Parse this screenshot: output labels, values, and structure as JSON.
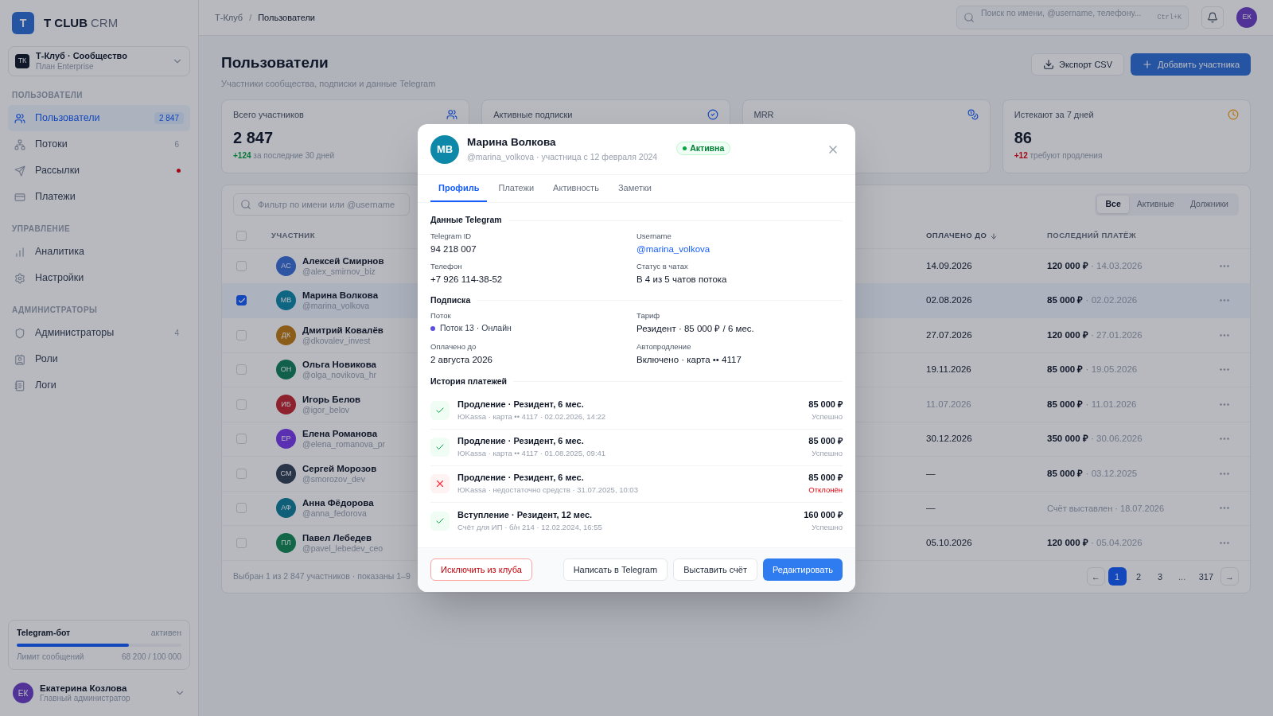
{
  "sidebar": {
    "logo": {
      "letter": "T",
      "name": "T CLUB",
      "suffix": "CRM"
    },
    "workspace": {
      "initials": "ТК",
      "name": "Т-Клуб · Сообщество",
      "plan": "План Enterprise"
    },
    "sections": [
      {
        "title": "ПОЛЬЗОВАТЕЛИ",
        "items": [
          {
            "label": "Пользователи",
            "count": "2 847",
            "dot": false,
            "selected": true
          },
          {
            "label": "Потоки",
            "count": "6",
            "dot": false,
            "selected": false
          },
          {
            "label": "Рассылки",
            "dot": true,
            "selected": false
          },
          {
            "label": "Платежи",
            "dot": false,
            "selected": false
          }
        ]
      },
      {
        "title": "УПРАВЛЕНИЕ",
        "items": [
          {
            "label": "Аналитика",
            "dot": false,
            "selected": false
          },
          {
            "label": "Настройки",
            "dot": false,
            "selected": false
          }
        ]
      },
      {
        "title": "АДМИНИСТРАТОРЫ",
        "items": [
          {
            "label": "Администраторы",
            "count": "4",
            "dot": false,
            "selected": false
          },
          {
            "label": "Роли",
            "dot": false,
            "selected": false
          },
          {
            "label": "Логи",
            "dot": false,
            "selected": false
          }
        ]
      }
    ],
    "bot": {
      "title": "Telegram-бот",
      "status": "активен",
      "level": 0.682,
      "label": "Лимит сообщений",
      "reading": "68 200 / 100 000"
    },
    "user": {
      "initials": "ЕК",
      "name": "Екатерина Козлова",
      "role": "Главный администратор"
    }
  },
  "header": {
    "breadcrumb": [
      "Т-Клуб",
      "Пользователи"
    ],
    "separator": "/",
    "search": {
      "placeholder": "Поиск по имени, @username, телефону...",
      "shortcut": "Ctrl+K"
    },
    "user_initials": "ЕК"
  },
  "page": {
    "title": "Пользователи",
    "subtitle": "Участники сообщества, подписки и данные Telegram",
    "buttons": [
      {
        "label": "Экспорт CSV",
        "kind": "secondary"
      },
      {
        "label": "Добавить участника",
        "kind": "primary"
      }
    ]
  },
  "stats": [
    {
      "label": "Всего участников",
      "value": "2 847",
      "delta": "+124",
      "note": "за последние 30 дней",
      "kind": "positive"
    },
    {
      "label": "Активные подписки"
    },
    {
      "label": "MRR"
    },
    {
      "label": "Истекают за 7 дней",
      "value": "86",
      "delta": "+12",
      "note": "требуют продления",
      "kind": "negative"
    }
  ],
  "table": {
    "filter": {
      "placeholder": "Фильтр по имени или @username"
    },
    "segments": [
      {
        "label": "Все",
        "selected": true
      },
      {
        "label": "Активные",
        "selected": false
      },
      {
        "label": "Должники",
        "selected": false
      }
    ],
    "all_checked": false,
    "separator": "·",
    "columns": [
      "УЧАСТНИК",
      "ОПЛАЧЕНО ДО",
      "ПОСЛЕДНИЙ ПЛАТЁЖ"
    ],
    "rows": [
      {
        "initials": "АС",
        "name": "Алексей Смирнов",
        "username": "@alex_smirnov_biz",
        "paid_until": "14.09.2026",
        "overdue": false,
        "kind": "paid",
        "amount": "120 000 ₽",
        "date": "14.03.2026",
        "selected": false
      },
      {
        "initials": "МВ",
        "name": "Марина Волкова",
        "username": "@marina_volkova",
        "paid_until": "02.08.2026",
        "overdue": false,
        "kind": "paid",
        "amount": "85 000 ₽",
        "date": "02.02.2026",
        "selected": true
      },
      {
        "initials": "ДК",
        "name": "Дмитрий Ковалёв",
        "username": "@dkovalev_invest",
        "paid_until": "27.07.2026",
        "overdue": false,
        "kind": "paid",
        "amount": "120 000 ₽",
        "date": "27.01.2026",
        "selected": false
      },
      {
        "initials": "ОН",
        "name": "Ольга Новикова",
        "username": "@olga_novikova_hr",
        "paid_until": "19.11.2026",
        "overdue": false,
        "kind": "paid",
        "amount": "85 000 ₽",
        "date": "19.05.2026",
        "selected": false
      },
      {
        "initials": "ИБ",
        "name": "Игорь Белов",
        "username": "@igor_belov",
        "paid_until": "11.07.2026",
        "overdue": true,
        "kind": "paid",
        "amount": "85 000 ₽",
        "date": "11.01.2026",
        "selected": false
      },
      {
        "initials": "ЕР",
        "name": "Елена Романова",
        "username": "@elena_romanova_pr",
        "paid_until": "30.12.2026",
        "overdue": false,
        "kind": "paid",
        "amount": "350 000 ₽",
        "date": "30.06.2026",
        "selected": false
      },
      {
        "initials": "СМ",
        "name": "Сергей Морозов",
        "username": "@smorozov_dev",
        "paid_until": "—",
        "overdue": false,
        "kind": "paid",
        "amount": "85 000 ₽",
        "date": "03.12.2025",
        "selected": false
      },
      {
        "initials": "АФ",
        "name": "Анна Фёдорова",
        "username": "@anna_fedorova",
        "paid_until": "—",
        "overdue": false,
        "kind": "invoice",
        "text": "Счёт выставлен · 18.07.2026",
        "selected": false
      },
      {
        "initials": "ПЛ",
        "name": "Павел Лебедев",
        "username": "@pavel_lebedev_ceo",
        "paid_until": "05.10.2026",
        "overdue": false,
        "kind": "paid",
        "amount": "120 000 ₽",
        "date": "05.04.2026",
        "selected": false
      }
    ],
    "footer": "Выбран 1 из 2 847 участников · показаны 1–9",
    "pagination": [
      {
        "label": "←",
        "kind": "arrow",
        "selected": false
      },
      {
        "label": "1",
        "kind": "page",
        "selected": true
      },
      {
        "label": "2",
        "kind": "page",
        "selected": false
      },
      {
        "label": "3",
        "kind": "page",
        "selected": false
      },
      {
        "label": "...",
        "kind": "gap"
      },
      {
        "label": "317",
        "kind": "page",
        "selected": false
      },
      {
        "label": "→",
        "kind": "arrow",
        "selected": false
      }
    ]
  },
  "modal": {
    "initials": "МВ",
    "name": "Марина Волкова",
    "subtitle": "@marina_volkova · участница с 12 февраля 2024",
    "badge": "Активна",
    "tabs": [
      {
        "label": "Профиль",
        "selected": true
      },
      {
        "label": "Платежи",
        "selected": false
      },
      {
        "label": "Активность",
        "selected": false
      },
      {
        "label": "Заметки",
        "selected": false
      }
    ],
    "sections": [
      {
        "title": "Данные Telegram",
        "fields": [
          {
            "label": "Telegram ID",
            "value": "94 218 007",
            "kind": "text"
          },
          {
            "label": "Username",
            "value": "@marina_volkova",
            "kind": "link"
          },
          {
            "label": "Телефон",
            "value": "+7 926 114-38-52",
            "kind": "text"
          },
          {
            "label": "Статус в чатах",
            "value": "В 4 из 5 чатов потока",
            "kind": "text"
          }
        ]
      },
      {
        "title": "Подписка",
        "fields": [
          {
            "label": "Поток",
            "value": "Поток 13 · Онлайн",
            "kind": "stream"
          },
          {
            "label": "Тариф",
            "value": "Резидент · 85 000 ₽ / 6 мес.",
            "kind": "text"
          },
          {
            "label": "Оплачено до",
            "value": "2 августа 2026",
            "kind": "text"
          },
          {
            "label": "Автопродление",
            "value": "Включено · карта •• 4117",
            "kind": "text"
          }
        ]
      }
    ],
    "history_title": "История платежей",
    "payments": [
      {
        "title": "Продление · Резидент, 6 мес.",
        "meta": "ЮKassa · карта •• 4117 · 02.02.2026, 14:22",
        "amount": "85 000 ₽",
        "status_text": "Успешно",
        "kind": "success"
      },
      {
        "title": "Продление · Резидент, 6 мес.",
        "meta": "ЮKassa · карта •• 4117 · 01.08.2025, 09:41",
        "amount": "85 000 ₽",
        "status_text": "Успешно",
        "kind": "success"
      },
      {
        "title": "Продление · Резидент, 6 мес.",
        "meta": "ЮKassa · недостаточно средств · 31.07.2025, 10:03",
        "amount": "85 000 ₽",
        "status_text": "Отклонён",
        "kind": "failed"
      },
      {
        "title": "Вступление · Резидент, 12 мес.",
        "meta": "Счёт для ИП · б/н 214 · 12.02.2024, 16:55",
        "amount": "160 000 ₽",
        "status_text": "Успешно",
        "kind": "success"
      }
    ],
    "actions": [
      {
        "label": "Исключить из клуба",
        "kind": "danger"
      },
      {
        "label": "Написать в Telegram",
        "kind": "secondary"
      },
      {
        "label": "Выставить счёт",
        "kind": "secondary"
      },
      {
        "label": "Редактировать",
        "kind": "primary"
      }
    ]
  }
}
